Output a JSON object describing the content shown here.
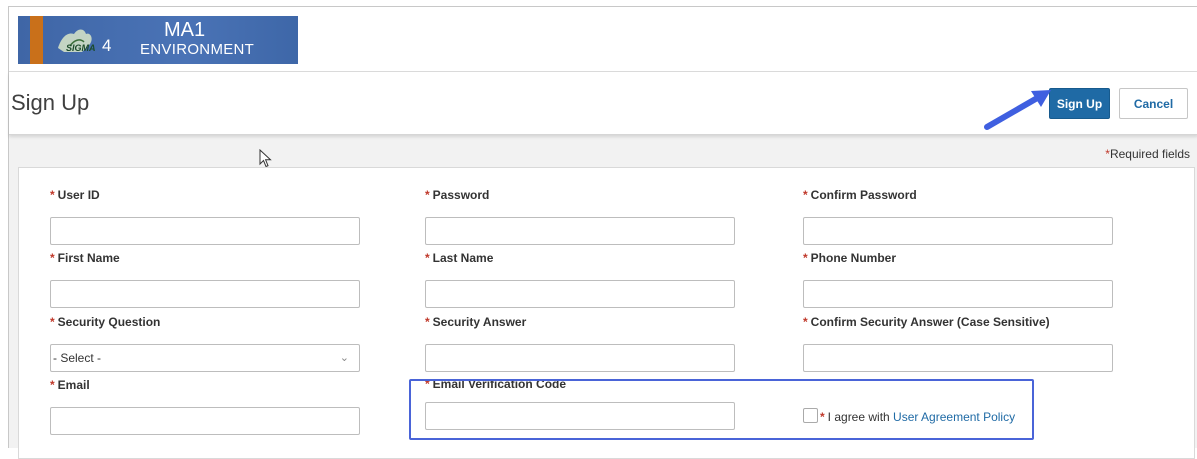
{
  "banner": {
    "env_line1": "MA1",
    "env_line2": "ENVIRONMENT",
    "logo_text": "SIGMA4",
    "accent_color": "#c9701a",
    "bg_color": "#4a73b6"
  },
  "header": {
    "title": "Sign Up",
    "sign_up_label": "Sign Up",
    "cancel_label": "Cancel"
  },
  "required_note": {
    "star": "*",
    "text": "Required fields"
  },
  "form": {
    "required_marker": "*",
    "user_id": {
      "label": "User ID",
      "value": ""
    },
    "password": {
      "label": "Password",
      "value": ""
    },
    "confirm_password": {
      "label": "Confirm Password",
      "value": ""
    },
    "first_name": {
      "label": "First Name",
      "value": ""
    },
    "last_name": {
      "label": "Last Name",
      "value": ""
    },
    "phone_number": {
      "label": "Phone Number",
      "value": ""
    },
    "security_question": {
      "label": "Security Question",
      "selected": "- Select -"
    },
    "security_answer": {
      "label": "Security Answer",
      "value": ""
    },
    "confirm_security_answer": {
      "label": "Confirm Security Answer (Case Sensitive)",
      "value": ""
    },
    "email": {
      "label": "Email",
      "value": ""
    },
    "email_verification_code": {
      "label": "Email Verification Code",
      "value": ""
    },
    "agreement": {
      "text": "I agree with ",
      "link": "User Agreement Policy",
      "checked": false
    }
  },
  "colors": {
    "primary": "#1f6aa5",
    "required": "#c0392b",
    "highlight": "#4a64d8"
  }
}
